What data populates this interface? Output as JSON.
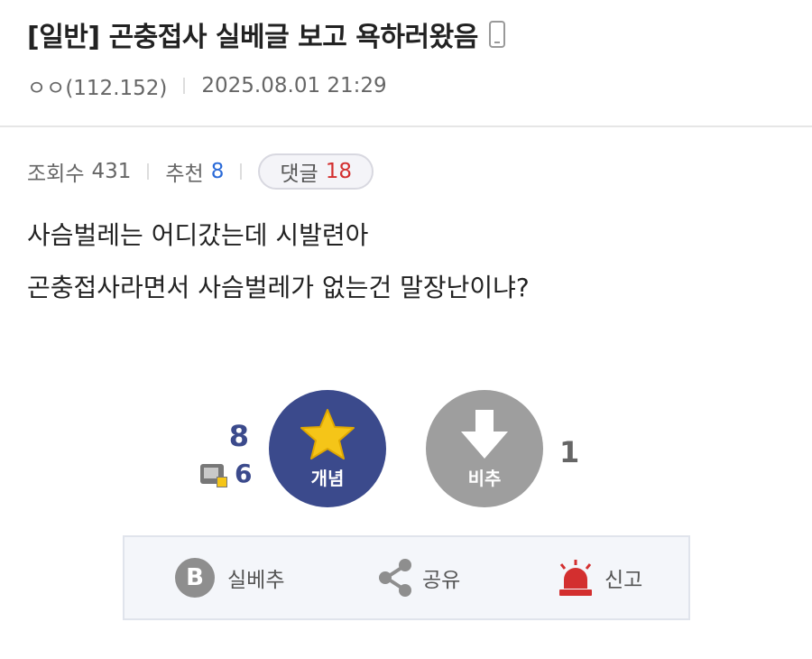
{
  "post": {
    "title": "[일반] 곤충접사 실베글 보고 욕하러왔음",
    "author": "ㅇㅇ(112.152)",
    "date": "2025.08.01 21:29",
    "views_label": "조회수",
    "views": "431",
    "recommend_label": "추천",
    "recommend": "8",
    "comments_label": "댓글",
    "comments": "18",
    "body_lines": [
      "사슴벌레는 어디갔는데 시발련아",
      "곤충접사라면서 사슴벌레가 없는건 말장난이냐?"
    ]
  },
  "vote": {
    "up_count": "8",
    "fix_count": "6",
    "up_label": "개념",
    "down_label": "비추",
    "down_count": "1",
    "up_color": "#3b4a8c",
    "down_color": "#9e9e9e",
    "star_color": "#f5c518"
  },
  "actions": {
    "best_icon_letter": "B",
    "best_label": "실베추",
    "share_label": "공유",
    "report_label": "신고",
    "report_color": "#d32f2f"
  },
  "icons": [
    "mobile-icon",
    "star-icon",
    "down-arrow-icon",
    "fix-icon",
    "best-b-icon",
    "share-icon",
    "siren-icon"
  ]
}
